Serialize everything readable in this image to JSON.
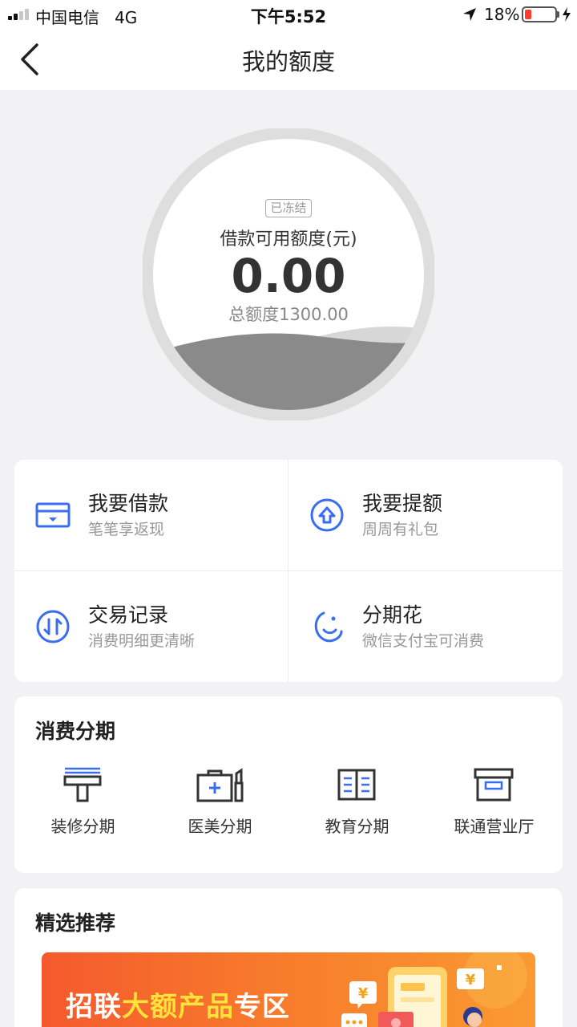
{
  "status_bar": {
    "carrier": "中国电信",
    "network": "4G",
    "time": "下午5:52",
    "battery_pct": "18%"
  },
  "nav": {
    "title": "我的额度"
  },
  "gauge": {
    "frozen_badge": "已冻结",
    "label": "借款可用额度(元)",
    "value": "0.00",
    "total": "总额度1300.00"
  },
  "grid": [
    {
      "title": "我要借款",
      "subtitle": "笔笔享返现",
      "icon": "wallet-icon"
    },
    {
      "title": "我要提额",
      "subtitle": "周周有礼包",
      "icon": "arrow-up-house-icon"
    },
    {
      "title": "交易记录",
      "subtitle": "消费明细更清晰",
      "icon": "exchange-icon"
    },
    {
      "title": "分期花",
      "subtitle": "微信支付宝可消费",
      "icon": "moon-smile-icon"
    }
  ],
  "installments": {
    "title": "消费分期",
    "items": [
      {
        "label": "装修分期",
        "icon": "paint-roller-icon"
      },
      {
        "label": "医美分期",
        "icon": "medical-kit-icon"
      },
      {
        "label": "教育分期",
        "icon": "book-icon"
      },
      {
        "label": "联通营业厅",
        "icon": "box-store-icon"
      }
    ]
  },
  "recommend": {
    "title": "精选推荐",
    "banner": {
      "prefix": "招联",
      "highlight": "大额产品",
      "suffix": "专区"
    }
  },
  "colors": {
    "accent": "#3a6df0",
    "banner_start": "#f5592d",
    "banner_end": "#fa9a32",
    "highlight": "#ffe23a"
  }
}
